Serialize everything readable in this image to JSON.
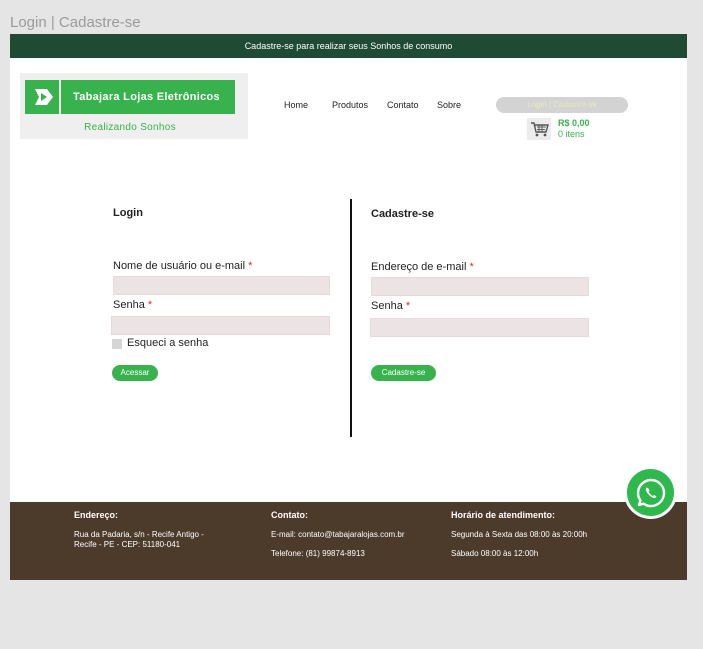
{
  "frame_title": "Login | Cadastre-se",
  "topbar": {
    "text": "Cadastre-se para realizar seus Sonhos de consumo"
  },
  "logo": {
    "name": "Tabajara Lojas Eletrônicos",
    "tagline": "Realizando Sonhos"
  },
  "nav": {
    "home": "Home",
    "produtos": "Produtos",
    "contato": "Contato",
    "sobre": "Sobre"
  },
  "header_login": "Login | Cadastre-se",
  "cart": {
    "price": "R$ 0,00",
    "items": "0 itens"
  },
  "login": {
    "title": "Login",
    "username_label": "Nome de usuário ou e-mail",
    "password_label": "Senha",
    "required_mark": "*",
    "remember_label": "Esqueci a senha",
    "submit": "Acessar"
  },
  "register": {
    "title": "Cadastre-se",
    "email_label": "Endereço de e-mail",
    "password_label": "Senha",
    "required_mark": "*",
    "submit": "Cadastre-se"
  },
  "footer": {
    "address_title": "Endereço:",
    "address_line1": "Rua da Padaria, s/n - Recife Antigo -",
    "address_line2": "Recife - PE - CEP: 51180-041",
    "contact_title": "Contato:",
    "contact_email": "E-mail: contato@tabajaralojas.com.br",
    "contact_phone": "Telefone: (81) 99874-8913",
    "hours_title": "Horário de atendimento:",
    "hours_weekday": "Segunda à Sexta das 08:00 às 20:00h",
    "hours_saturday": "Sábado 08:00 às 12:00h"
  },
  "colors": {
    "brand_green": "#37b24d",
    "topbar_bg": "#1f4a33",
    "footer_bg": "#4c3a2a",
    "input_bg": "#ece4e4",
    "required": "#c0392b"
  },
  "icons": {
    "logo": "logo-play-icon",
    "cart": "cart-icon",
    "whatsapp": "whatsapp-icon"
  }
}
